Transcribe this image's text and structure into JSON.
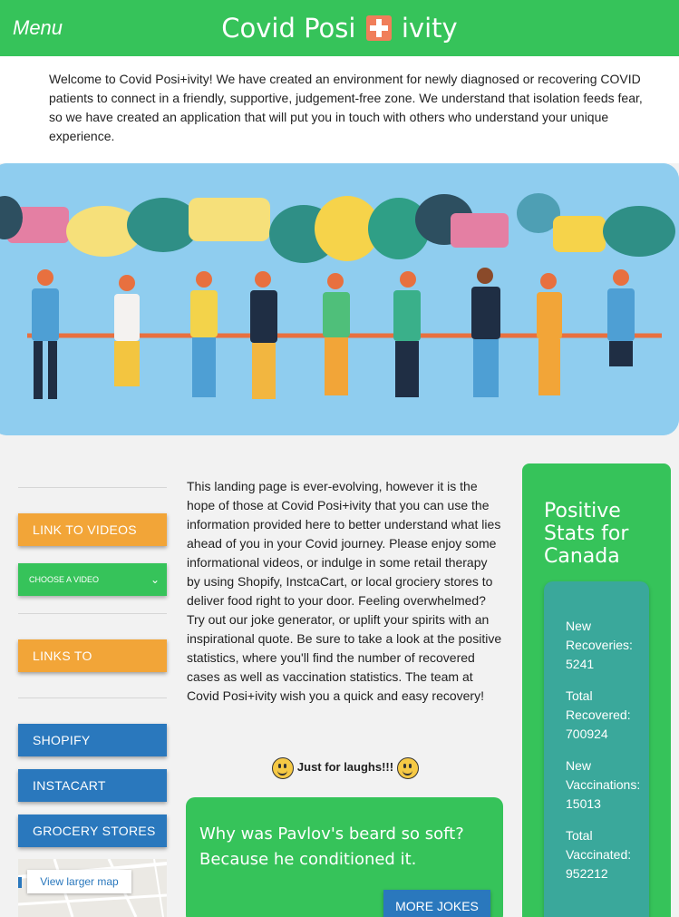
{
  "header": {
    "menu_label": "Menu",
    "title_left": "Covid Posi",
    "title_right": "ivity",
    "brand_color": "#36c35a"
  },
  "intro": "Welcome to Covid Posi+ivity! We have created an environment for newly diagnosed or recovering COVID patients to connect in a friendly, supportive, judgement-free zone. We understand that isolation feeds fear, so we have created an application that will put you in touch with others who understand your unique experience.",
  "sidebar": {
    "videos_button": "LINK TO VIDEOS",
    "video_select": "CHOOSE A VIDEO",
    "links_button": "LINKS TO",
    "shopify": "SHOPIFY",
    "instacart": "INSTACART",
    "grocery": "GROCERY STORES",
    "map_link": "View larger map"
  },
  "main": {
    "body": "This landing page is ever-evolving, however it is the hope of those at Covid Posi+ivity that you can use the information provided here to better understand what lies ahead of you in your Covid journey. Please enjoy some informational videos, or indulge in some retail therapy by using Shopify, InstcaCart, or local grociery stores to deliver food right to your door. Feeling overwhelmed? Try out our joke generator, or uplift your spirits with an inspirational quote. Be sure to take a look at the positive statistics, where you'll find the number of recovered cases as well as vaccination statistics. The team at Covid Posi+ivity wish you a quick and easy recovery!",
    "laughs_label": "Just for laughs!!!",
    "joke": "Why was Pavlov's beard so soft? Because he conditioned it.",
    "more_jokes": "MORE JOKES"
  },
  "stats": {
    "title": "Positive Stats for Canada",
    "items": [
      {
        "label": "New Recoveries:",
        "value": "5241"
      },
      {
        "label": "Total Recovered:",
        "value": "700924"
      },
      {
        "label": "New Vaccinations:",
        "value": "15013"
      },
      {
        "label": "Total Vaccinated:",
        "value": "952212"
      }
    ]
  },
  "colors": {
    "green": "#36c35a",
    "orange": "#f2a538",
    "blue": "#2a78bd",
    "teal": "#3aa89b"
  }
}
